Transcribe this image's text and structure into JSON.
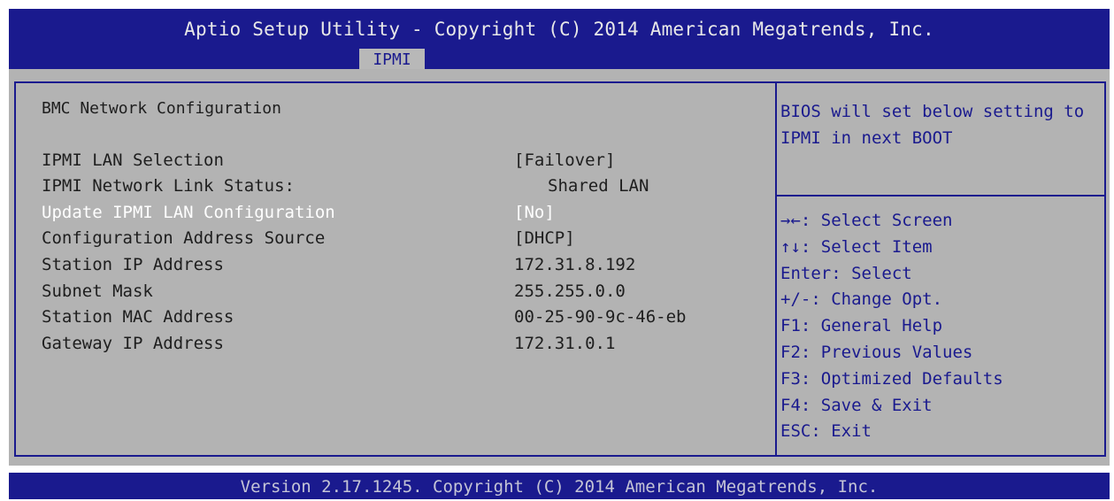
{
  "header": {
    "title": "Aptio Setup Utility - Copyright (C) 2014 American Megatrends, Inc.",
    "tab_label": "IPMI"
  },
  "main": {
    "section_title": "BMC Network Configuration",
    "rows": [
      {
        "label": "IPMI LAN Selection",
        "value": "[Failover]"
      },
      {
        "label": "IPMI Network Link Status:",
        "value": "Shared LAN"
      },
      {
        "label": "Update IPMI LAN Configuration",
        "value": "[No]"
      },
      {
        "label": "Configuration Address Source",
        "value": "[DHCP]"
      },
      {
        "label": "Station IP Address",
        "value": "172.31.8.192"
      },
      {
        "label": "Subnet Mask",
        "value": "255.255.0.0"
      },
      {
        "label": "Station MAC Address",
        "value": "00-25-90-9c-46-eb"
      },
      {
        "label": "Gateway IP Address",
        "value": "172.31.0.1"
      }
    ]
  },
  "help": {
    "description": "BIOS will set below setting to IPMI in next BOOT",
    "keys": [
      "→←: Select Screen",
      "↑↓: Select Item",
      "Enter: Select",
      "+/-: Change Opt.",
      "F1: General Help",
      "F2: Previous Values",
      "F3: Optimized Defaults",
      "F4: Save & Exit",
      "ESC: Exit"
    ]
  },
  "footer": {
    "version_text": "Version 2.17.1245. Copyright (C) 2014 American Megatrends, Inc."
  },
  "colors": {
    "bar_blue": "#1a1a8e",
    "panel_gray": "#b3b3b3",
    "text_dark": "#1e1e1e",
    "highlight_white": "#ffffff"
  }
}
